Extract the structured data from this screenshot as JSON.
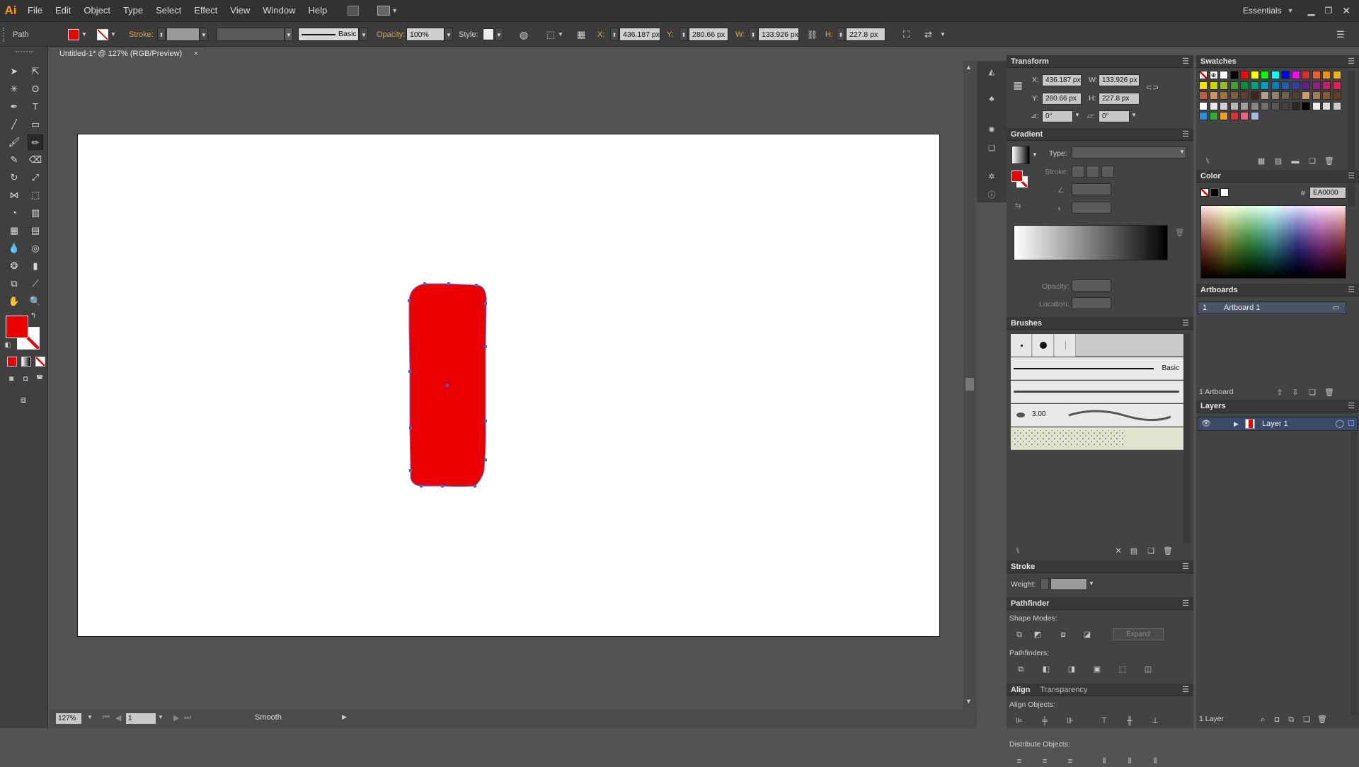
{
  "app": {
    "logo": "Ai",
    "workspace": "Essentials"
  },
  "menu": [
    "File",
    "Edit",
    "Object",
    "Type",
    "Select",
    "Effect",
    "View",
    "Window",
    "Help"
  ],
  "control": {
    "selection": "Path",
    "stroke_label": "Stroke:",
    "brush": "Basic",
    "opacity_label": "Opacity:",
    "opacity": "100%",
    "style_label": "Style:",
    "x_label": "X:",
    "x": "436.187 px",
    "y_label": "Y:",
    "y": "280.66 px",
    "w_label": "W:",
    "w": "133.926 px",
    "h_label": "H:",
    "h": "227.8 px",
    "fill_color": "#EA0000"
  },
  "document": {
    "tab": "Untitled-1* @ 127% (RGB/Preview)",
    "close": "×"
  },
  "status": {
    "zoom": "127%",
    "artboard": "1",
    "tool": "Smooth"
  },
  "transform": {
    "title": "Transform",
    "x_label": "X:",
    "x": "436.187 px",
    "w_label": "W:",
    "w": "133.926 px",
    "y_label": "Y:",
    "y": "280.66 px",
    "h_label": "H:",
    "h": "227.8 px",
    "angle": "0°",
    "shear": "0°"
  },
  "gradient": {
    "title": "Gradient",
    "type_label": "Type:",
    "stroke_label": "Stroke:",
    "opacity_label": "Opacity:",
    "location_label": "Location:"
  },
  "brushes": {
    "title": "Brushes",
    "basic": "Basic",
    "size": "3.00"
  },
  "stroke": {
    "title": "Stroke",
    "weight_label": "Weight:"
  },
  "pathfinder": {
    "title": "Pathfinder",
    "shape_modes": "Shape Modes:",
    "expand": "Expand",
    "pathfinders": "Pathfinders:"
  },
  "align": {
    "title": "Align",
    "tab2": "Transparency",
    "align_objects": "Align Objects:",
    "distribute_objects": "Distribute Objects:"
  },
  "swatches": {
    "title": "Swatches"
  },
  "color": {
    "title": "Color",
    "hex_label": "#",
    "hex": "EA0000"
  },
  "artboards": {
    "title": "Artboards",
    "row_num": "1",
    "row_name": "Artboard 1",
    "count": "1 Artboard"
  },
  "layers": {
    "title": "Layers",
    "layer_name": "Layer 1",
    "count": "1 Layer"
  }
}
